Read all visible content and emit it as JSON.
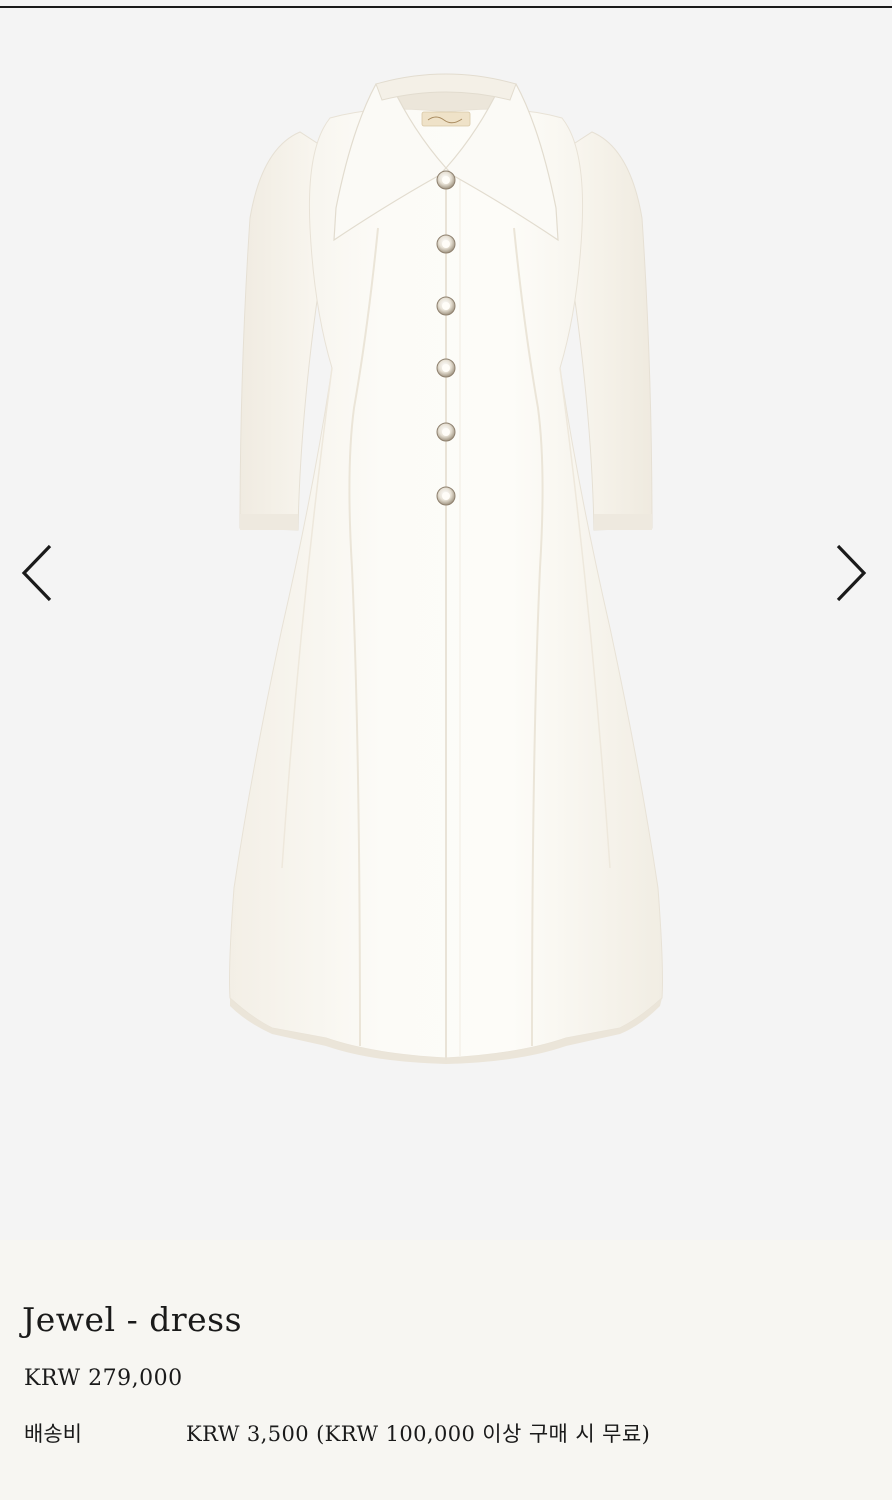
{
  "product": {
    "title": "Jewel - dress",
    "price": "KRW 279,000",
    "shipping_label": "배송비",
    "shipping_value": "KRW 3,500 (KRW 100,000 이상 구매 시 무료)",
    "image_label": "Ivory A-line coat dress with pointed collar and jewel buttons"
  },
  "gallery": {
    "prev_icon": "chevron-left-icon",
    "next_icon": "chevron-right-icon"
  },
  "colors": {
    "gallery_background": "#f4f4f4",
    "info_background": "#f7f6f2",
    "text": "#1a1a1a",
    "dress": "#fbf9f3"
  }
}
